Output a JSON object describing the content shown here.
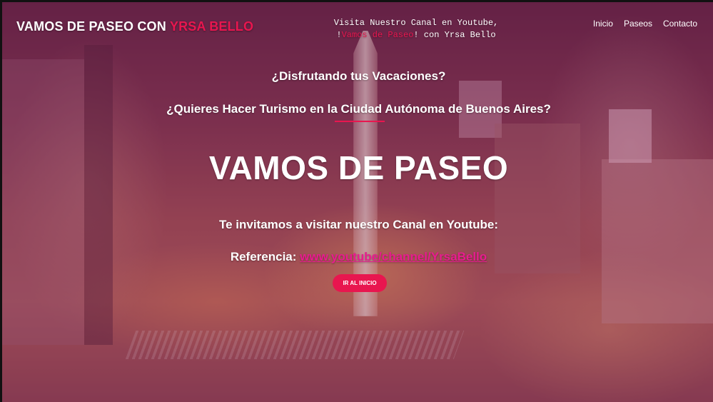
{
  "header": {
    "brand_main": "VAMOS DE PASEO CON",
    "brand_accent": "YRSA BELLO",
    "promo_line1": "Visita Nuestro Canal en Youtube,",
    "promo_prefix": "!",
    "promo_accent": "Vamos de Paseo",
    "promo_suffix": "! con Yrsa Bello",
    "nav": [
      "Inicio",
      "Paseos",
      "Contacto"
    ]
  },
  "hero": {
    "question1": "¿Disfrutando tus Vacaciones?",
    "question2": "¿Quieres Hacer Turismo en la Ciudad Autónoma de Buenos Aires?",
    "title": "VAMOS DE PASEO",
    "invite": "Te invitamos a visitar nuestro Canal en Youtube:",
    "reference_label": "Referencia:",
    "reference_link": "www.youtube/channel/YrsaBello",
    "button_label": "IR AL INICIO"
  },
  "colors": {
    "accent": "#e8164f",
    "link": "#e81c8f"
  }
}
